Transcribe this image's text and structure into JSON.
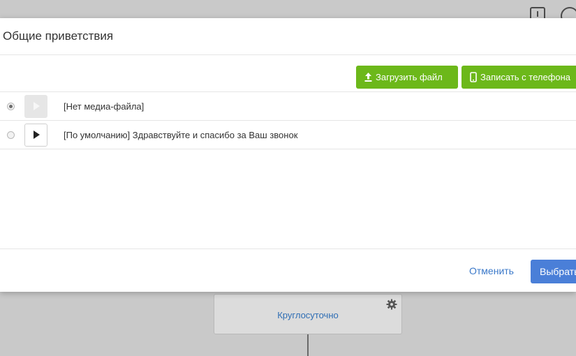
{
  "background": {
    "node_label": "Круглосуточно"
  },
  "modal": {
    "title": "Общие приветствия",
    "toolbar": {
      "upload_label": "Загрузить файл",
      "record_label": "Записать с телефона"
    },
    "media_list": [
      {
        "label": "[Нет медиа-файла]",
        "selected": true,
        "playable": false
      },
      {
        "label": "[По умолчанию] Здравствуйте и спасибо за Ваш звонок",
        "selected": false,
        "playable": true
      }
    ],
    "footer": {
      "cancel_label": "Отменить",
      "select_label": "Выбрать"
    }
  },
  "colors": {
    "accent_green": "#6cb81a",
    "primary_blue": "#4a7fd8",
    "link_blue": "#3a78c9"
  }
}
